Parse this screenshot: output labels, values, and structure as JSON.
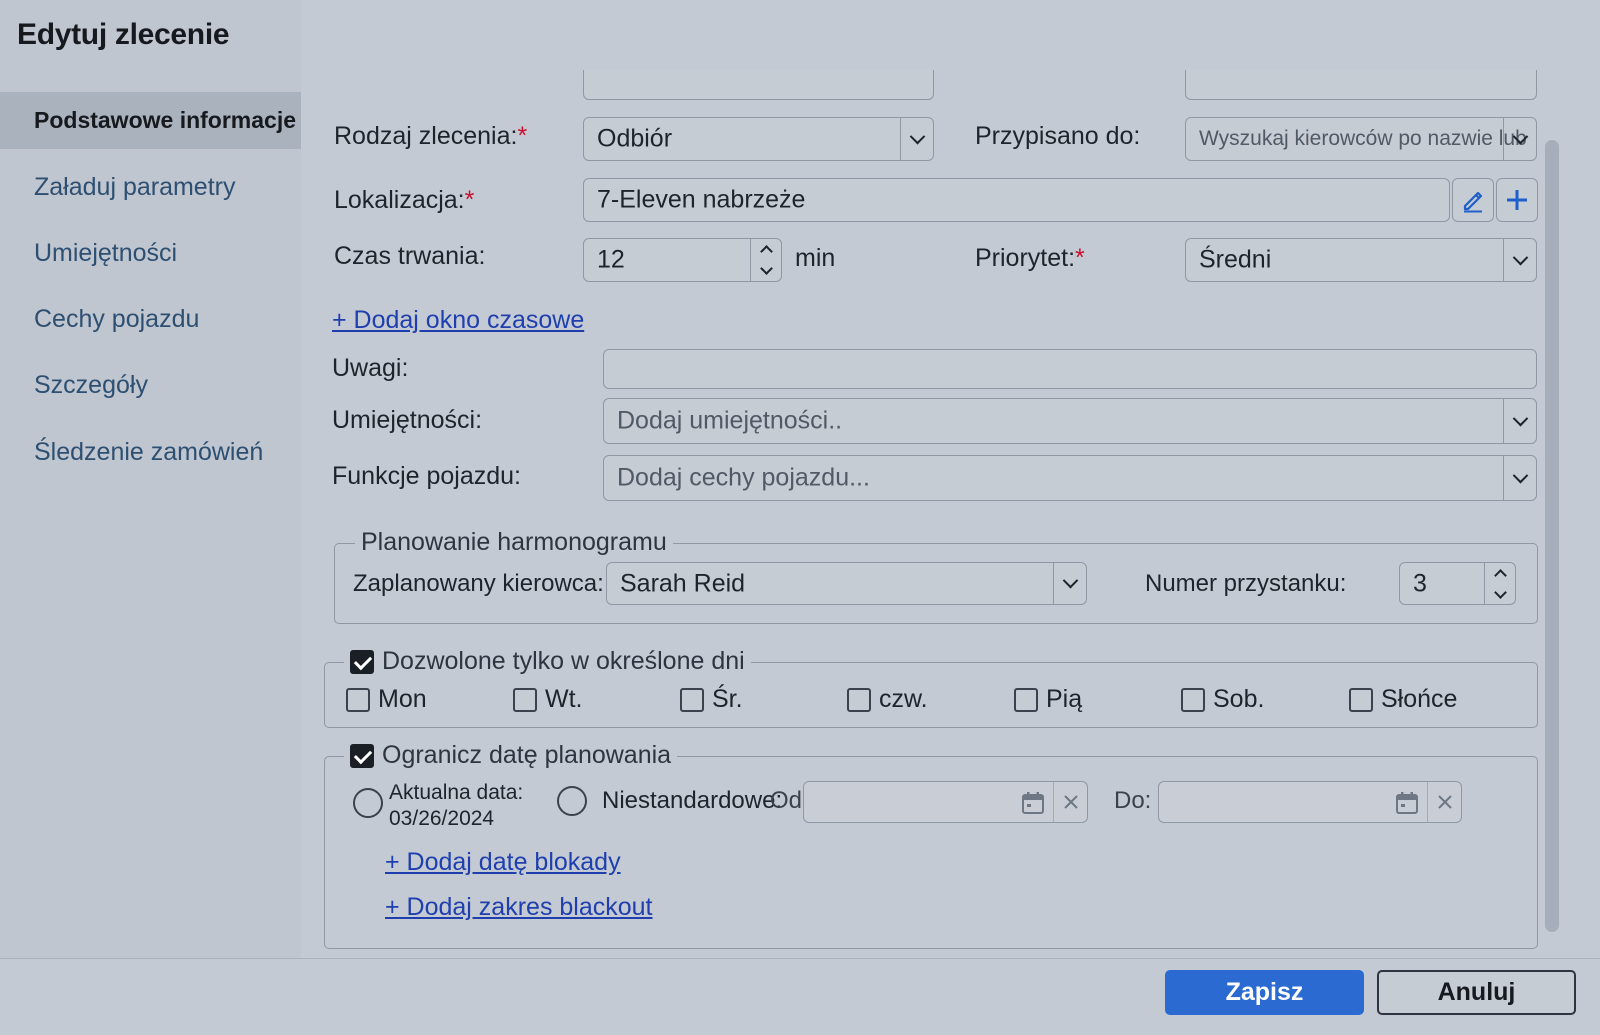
{
  "dialog": {
    "title": "Edytuj zlecenie"
  },
  "sidebar": {
    "items": [
      {
        "label": "Podstawowe informacje",
        "active": true
      },
      {
        "label": "Załaduj parametry"
      },
      {
        "label": "Umiejętności"
      },
      {
        "label": "Cechy pojazdu"
      },
      {
        "label": "Szczegóły"
      },
      {
        "label": "Śledzenie zamówień"
      }
    ]
  },
  "form": {
    "order_type": {
      "label": "Rodzaj zlecenia:",
      "value": "Odbiór"
    },
    "assigned_to": {
      "label": "Przypisano do:",
      "placeholder": "Wyszukaj kierowców po nazwie lub"
    },
    "location": {
      "label": "Lokalizacja:",
      "value": "7-Eleven nabrzeże"
    },
    "duration": {
      "label": "Czas trwania:",
      "value": "12",
      "unit": "min"
    },
    "priority": {
      "label": "Priorytet:",
      "value": "Średni"
    },
    "add_time_window": "+ Dodaj okno czasowe",
    "notes": {
      "label": "Uwagi:",
      "value": ""
    },
    "skills": {
      "label": "Umiejętności:",
      "placeholder": "Dodaj umiejętności.."
    },
    "vehicle_features": {
      "label": "Funkcje pojazdu:",
      "placeholder": "Dodaj cechy pojazdu..."
    },
    "required_marker": "*"
  },
  "schedule": {
    "legend": "Planowanie harmonogramu",
    "driver": {
      "label": "Zaplanowany kierowca:",
      "value": "Sarah Reid"
    },
    "stop_number": {
      "label": "Numer przystanku:",
      "value": "3"
    }
  },
  "allowed_days": {
    "legend": "Dozwolone tylko w określone dni",
    "checked": true,
    "days": [
      {
        "label": "Mon",
        "checked": false
      },
      {
        "label": "Wt.",
        "checked": false
      },
      {
        "label": "Śr.",
        "checked": false
      },
      {
        "label": "czw.",
        "checked": false
      },
      {
        "label": "Pią",
        "checked": false
      },
      {
        "label": "Sob.",
        "checked": false
      },
      {
        "label": "Słońce",
        "checked": false
      }
    ]
  },
  "limit_date": {
    "legend": "Ogranicz datę planowania",
    "checked": true,
    "current_label": "Aktualna data:",
    "current_value": "03/26/2024",
    "custom_label": "Niestandardowe:",
    "from_label": "Od:",
    "to_label": "Do:",
    "add_blackout_date": "+ Dodaj datę blokady",
    "add_blackout_range": "+ Dodaj zakres blackout"
  },
  "footer": {
    "save": "Zapisz",
    "cancel": "Anuluj"
  },
  "icons": {
    "edit": "pencil-icon",
    "add": "plus-icon",
    "calendar": "calendar-icon",
    "clear": "close-icon",
    "dropdown": "chevron-down-icon"
  },
  "colors": {
    "primary": "#2a6ad1",
    "link": "#1f3fae",
    "required": "#c8102e"
  }
}
